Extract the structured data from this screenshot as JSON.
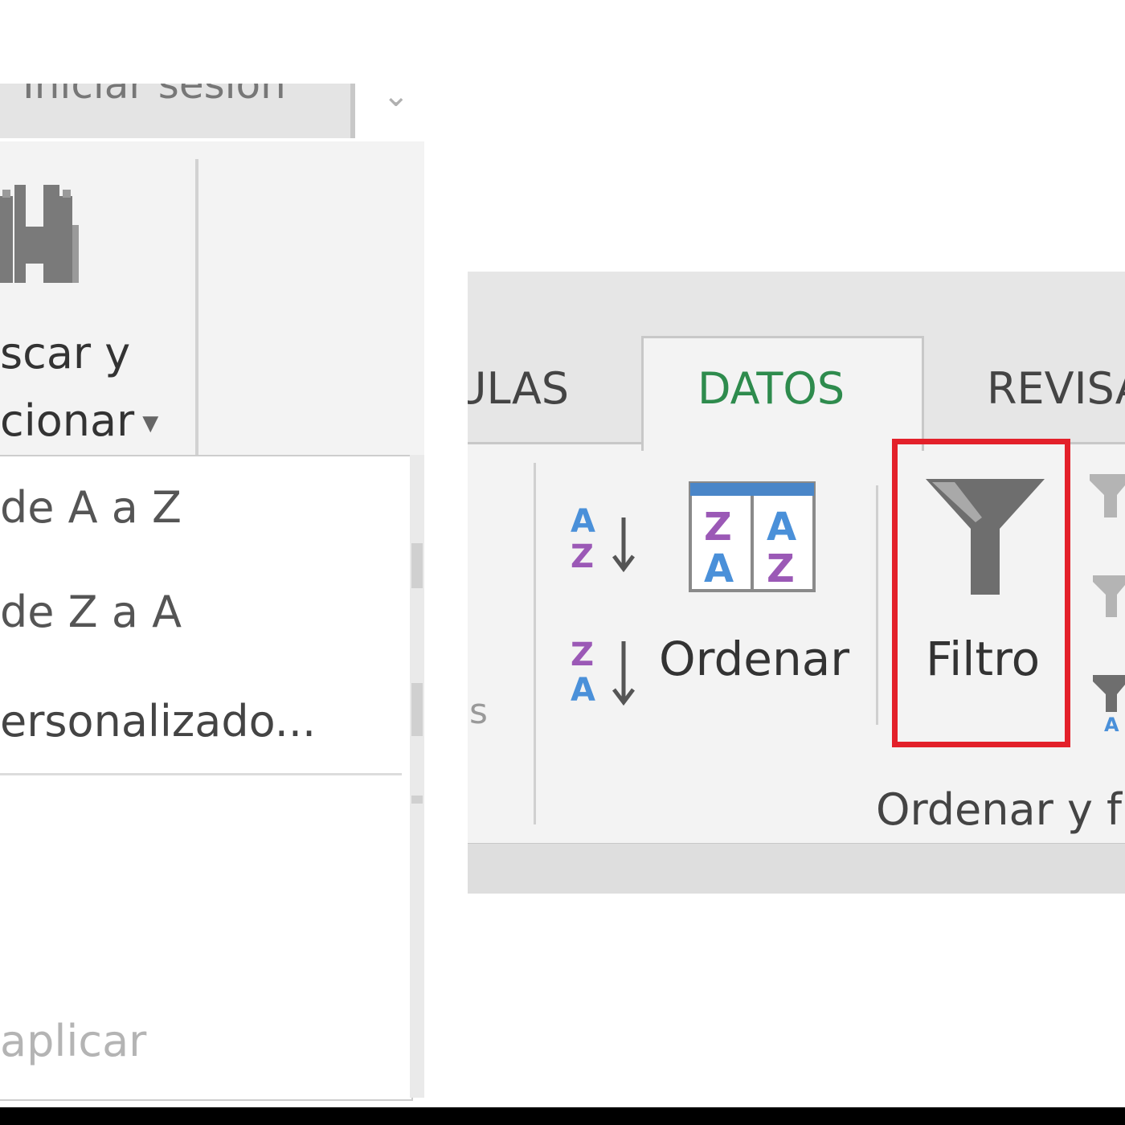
{
  "left_panel": {
    "tab_login_label": "Iniciar sesión",
    "find_select": {
      "line1": "scar y",
      "line2": "cionar",
      "icon": "binoculars-icon"
    },
    "sort_menu": {
      "items": [
        {
          "label": "de A a Z"
        },
        {
          "label": "de Z a A"
        },
        {
          "label": "ersonalizado..."
        },
        {
          "label": "aplicar",
          "disabled": true
        }
      ]
    }
  },
  "right_panel": {
    "tabs": [
      {
        "label": "ULAS"
      },
      {
        "label": "DATOS",
        "active": true
      },
      {
        "label": "REVISA"
      }
    ],
    "partial_group_text": "s",
    "sort_buttons": {
      "az": {
        "top": "A",
        "bottom": "Z",
        "icon": "sort-ascending-icon"
      },
      "za": {
        "top": "Z",
        "bottom": "A",
        "icon": "sort-descending-icon"
      }
    },
    "ordenar_button": {
      "label": "Ordenar",
      "icon": "sort-dialog-icon",
      "letters": {
        "left_top": "Z",
        "left_bottom": "A",
        "right_top": "A",
        "right_bottom": "Z"
      }
    },
    "filtro_button": {
      "label": "Filtro",
      "icon": "funnel-icon",
      "highlighted": true
    },
    "group_label": "Ordenar y f",
    "mini_icon_letter": "A"
  },
  "colors": {
    "active_tab_text": "#2e8b4d",
    "highlight": "#e3202a",
    "letter_blue": "#4a90d9",
    "letter_purple": "#9b59b6",
    "ribbon_bg": "#f3f3f3"
  }
}
